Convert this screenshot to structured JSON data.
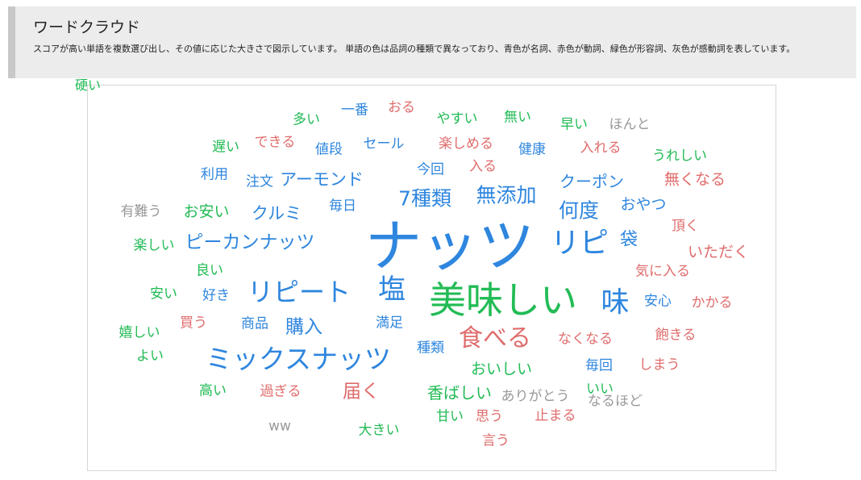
{
  "header": {
    "title": "ワードクラウド",
    "description": "スコアが高い単語を複数選び出し、その値に応じた大きさで図示しています。 単語の色は品詞の種類で異なっており、青色が名詞、赤色が動詞、緑色が形容詞、灰色が感動詞を表しています。"
  },
  "colors": {
    "noun": "#2e86de",
    "verb": "#e06c6c",
    "adjective": "#22bb55",
    "interjection": "#9a9a9a"
  },
  "words": [
    {
      "text": "多い",
      "pos": "adjective"
    },
    {
      "text": "一番",
      "pos": "noun"
    },
    {
      "text": "おる",
      "pos": "verb"
    },
    {
      "text": "やすい",
      "pos": "adjective"
    },
    {
      "text": "無い",
      "pos": "adjective"
    },
    {
      "text": "早い",
      "pos": "adjective"
    },
    {
      "text": "ほんと",
      "pos": "interjection"
    },
    {
      "text": "遅い",
      "pos": "adjective"
    },
    {
      "text": "できる",
      "pos": "verb"
    },
    {
      "text": "値段",
      "pos": "noun"
    },
    {
      "text": "セール",
      "pos": "noun"
    },
    {
      "text": "楽しめる",
      "pos": "verb"
    },
    {
      "text": "健康",
      "pos": "noun"
    },
    {
      "text": "入れる",
      "pos": "verb"
    },
    {
      "text": "うれしい",
      "pos": "adjective"
    },
    {
      "text": "利用",
      "pos": "noun"
    },
    {
      "text": "注文",
      "pos": "noun"
    },
    {
      "text": "アーモンド",
      "pos": "noun"
    },
    {
      "text": "今回",
      "pos": "noun"
    },
    {
      "text": "入る",
      "pos": "verb"
    },
    {
      "text": "クーポン",
      "pos": "noun"
    },
    {
      "text": "無くなる",
      "pos": "verb"
    },
    {
      "text": "7種類",
      "pos": "noun"
    },
    {
      "text": "無添加",
      "pos": "noun"
    },
    {
      "text": "有難う",
      "pos": "interjection"
    },
    {
      "text": "お安い",
      "pos": "adjective"
    },
    {
      "text": "クルミ",
      "pos": "noun"
    },
    {
      "text": "毎日",
      "pos": "noun"
    },
    {
      "text": "何度",
      "pos": "noun"
    },
    {
      "text": "おやつ",
      "pos": "noun"
    },
    {
      "text": "頂く",
      "pos": "verb"
    },
    {
      "text": "ナッツ",
      "pos": "noun"
    },
    {
      "text": "楽しい",
      "pos": "adjective"
    },
    {
      "text": "ピーカンナッツ",
      "pos": "noun"
    },
    {
      "text": "リピ",
      "pos": "noun"
    },
    {
      "text": "袋",
      "pos": "noun"
    },
    {
      "text": "いただく",
      "pos": "verb"
    },
    {
      "text": "良い",
      "pos": "adjective"
    },
    {
      "text": "気に入る",
      "pos": "verb"
    },
    {
      "text": "安い",
      "pos": "adjective"
    },
    {
      "text": "好き",
      "pos": "noun"
    },
    {
      "text": "リピート",
      "pos": "noun"
    },
    {
      "text": "塩",
      "pos": "noun"
    },
    {
      "text": "美味しい",
      "pos": "adjective"
    },
    {
      "text": "味",
      "pos": "noun"
    },
    {
      "text": "安心",
      "pos": "noun"
    },
    {
      "text": "かかる",
      "pos": "verb"
    },
    {
      "text": "買う",
      "pos": "verb"
    },
    {
      "text": "商品",
      "pos": "noun"
    },
    {
      "text": "購入",
      "pos": "noun"
    },
    {
      "text": "満足",
      "pos": "noun"
    },
    {
      "text": "嬉しい",
      "pos": "adjective"
    },
    {
      "text": "食べる",
      "pos": "verb"
    },
    {
      "text": "なくなる",
      "pos": "verb"
    },
    {
      "text": "飽きる",
      "pos": "verb"
    },
    {
      "text": "よい",
      "pos": "adjective"
    },
    {
      "text": "ミックスナッツ",
      "pos": "noun"
    },
    {
      "text": "種類",
      "pos": "noun"
    },
    {
      "text": "おいしい",
      "pos": "adjective"
    },
    {
      "text": "毎回",
      "pos": "noun"
    },
    {
      "text": "しまう",
      "pos": "verb"
    },
    {
      "text": "高い",
      "pos": "adjective"
    },
    {
      "text": "過ぎる",
      "pos": "verb"
    },
    {
      "text": "届く",
      "pos": "verb"
    },
    {
      "text": "香ばしい",
      "pos": "adjective"
    },
    {
      "text": "ありがとう",
      "pos": "interjection"
    },
    {
      "text": "いい",
      "pos": "adjective"
    },
    {
      "text": "なるほど",
      "pos": "interjection"
    },
    {
      "text": "ww",
      "pos": "interjection"
    },
    {
      "text": "甘い",
      "pos": "adjective"
    },
    {
      "text": "思う",
      "pos": "verb"
    },
    {
      "text": "止まる",
      "pos": "verb"
    },
    {
      "text": "大きい",
      "pos": "adjective"
    },
    {
      "text": "言う",
      "pos": "verb"
    },
    {
      "text": "硬い",
      "pos": "adjective"
    }
  ]
}
